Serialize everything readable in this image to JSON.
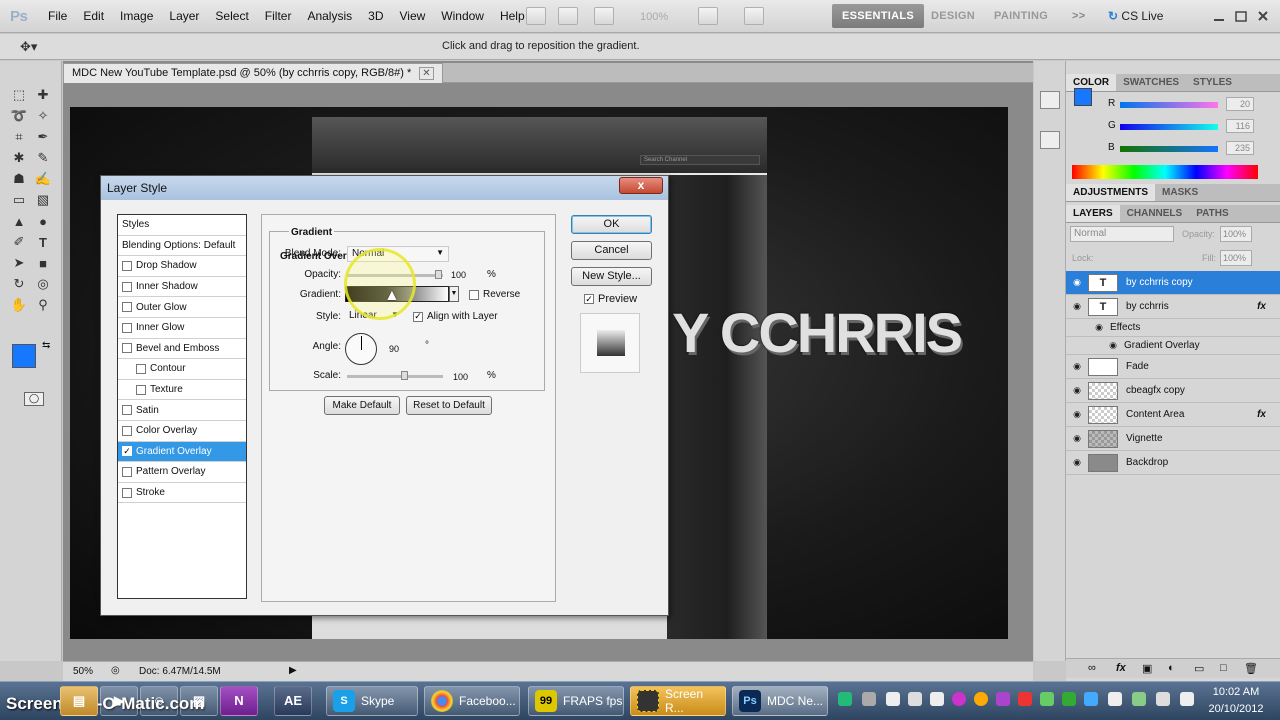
{
  "app": {
    "logo": "Ps",
    "menu": [
      "File",
      "Edit",
      "Image",
      "Layer",
      "Select",
      "Filter",
      "Analysis",
      "3D",
      "View",
      "Window",
      "Help"
    ],
    "zoom_display": "100%",
    "workspaces": [
      "ESSENTIALS",
      "DESIGN",
      "PAINTING",
      ">>"
    ],
    "cs_live": "CS Live",
    "options_hint": "Click and drag to reposition the gradient."
  },
  "document": {
    "tab_title": "MDC New YouTube Template.psd @ 50% (by cchrris  copy, RGB/8#) *",
    "search_placeholder": "Search Channel",
    "canvas_text": "Y CCHRRIS",
    "zoom_status": "50%",
    "doc_size": "Doc: 6.47M/14.5M"
  },
  "color_panel": {
    "tabs": [
      "COLOR",
      "SWATCHES",
      "STYLES"
    ],
    "fg_color": "#1578ff",
    "r": {
      "label": "R",
      "value": "20"
    },
    "g": {
      "label": "G",
      "value": "116"
    },
    "b": {
      "label": "B",
      "value": "235"
    }
  },
  "adjust_tabs": [
    "ADJUSTMENTS",
    "MASKS"
  ],
  "layers_panel": {
    "tabs": [
      "LAYERS",
      "CHANNELS",
      "PATHS"
    ],
    "blend_mode": "Normal",
    "opacity_label": "Opacity:",
    "opacity": "100%",
    "lock_label": "Lock:",
    "fill_label": "Fill:",
    "fill": "100%",
    "layers": [
      {
        "name": "by cchrris  copy",
        "thumb": "T",
        "fx": ""
      },
      {
        "name": "by cchrris",
        "thumb": "T",
        "fx": "fx"
      },
      {
        "name": "Effects",
        "thumb": "",
        "fx": ""
      },
      {
        "name": "Gradient Overlay",
        "thumb": "",
        "fx": ""
      },
      {
        "name": "Fade",
        "thumb": "",
        "fx": ""
      },
      {
        "name": "cbeagfx copy",
        "thumb": "",
        "fx": ""
      },
      {
        "name": "Content Area",
        "thumb": "",
        "fx": "fx"
      },
      {
        "name": "Vignette",
        "thumb": "",
        "fx": ""
      },
      {
        "name": "Backdrop",
        "thumb": "",
        "fx": ""
      }
    ]
  },
  "dialog": {
    "title": "Layer Style",
    "close": "x",
    "styles_header": "Styles",
    "blending_options": "Blending Options: Default",
    "styles": [
      {
        "label": "Drop Shadow",
        "checked": false
      },
      {
        "label": "Inner Shadow",
        "checked": false
      },
      {
        "label": "Outer Glow",
        "checked": false
      },
      {
        "label": "Inner Glow",
        "checked": false
      },
      {
        "label": "Bevel and Emboss",
        "checked": false
      },
      {
        "label": "Contour",
        "checked": false
      },
      {
        "label": "Texture",
        "checked": false
      },
      {
        "label": "Satin",
        "checked": false
      },
      {
        "label": "Color Overlay",
        "checked": false
      },
      {
        "label": "Gradient Overlay",
        "checked": true
      },
      {
        "label": "Pattern Overlay",
        "checked": false
      },
      {
        "label": "Stroke",
        "checked": false
      }
    ],
    "section_title": "Gradient Overlay",
    "group_title": "Gradient",
    "blend_mode_label": "Blend Mode:",
    "blend_mode_value": "Normal",
    "opacity_label": "Opacity:",
    "opacity_value": "100",
    "percent": "%",
    "gradient_label": "Gradient:",
    "reverse_label": "Reverse",
    "style_label": "Style:",
    "style_value": "Linear",
    "align_label": "Align with Layer",
    "angle_label": "Angle:",
    "angle_value": "90",
    "degree": "°",
    "scale_label": "Scale:",
    "scale_value": "100",
    "make_default": "Make Default",
    "reset_default": "Reset to Default",
    "ok": "OK",
    "cancel": "Cancel",
    "new_style": "New Style...",
    "preview_label": "Preview"
  },
  "taskbar": {
    "watermark": "Screencast-O-Matic.com",
    "apps": [
      "Skype",
      "Faceboo...",
      "FRAPS fps",
      "Screen R...",
      "MDC Ne..."
    ],
    "ae_label": "AE",
    "time": "10:02 AM",
    "date": "20/10/2012"
  }
}
